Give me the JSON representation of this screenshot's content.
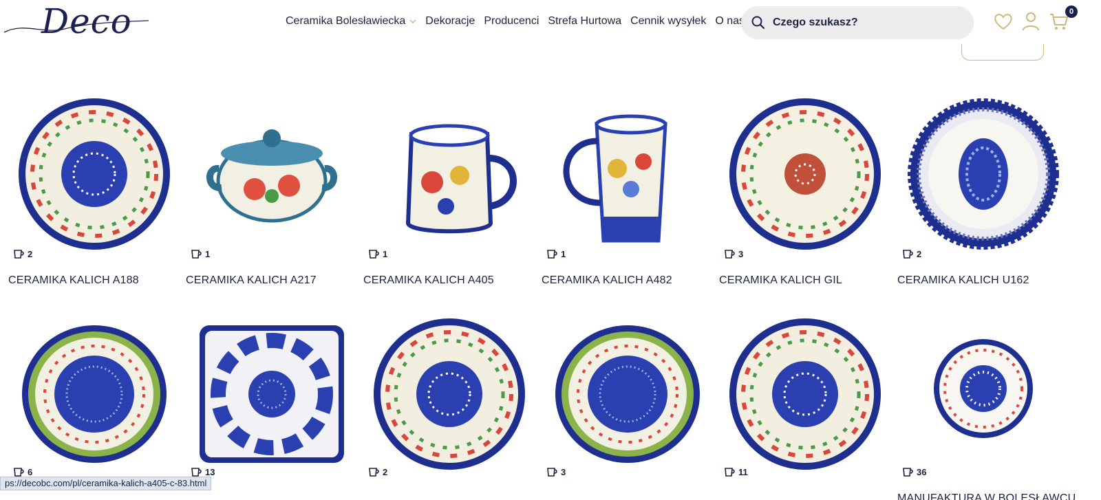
{
  "brand": {
    "logo_text": "Deco"
  },
  "nav": {
    "items": [
      "Ceramika Bolesławiecka",
      "Dekoracje",
      "Producenci",
      "Strefa Hurtowa",
      "Cennik wysyłek",
      "O nas"
    ]
  },
  "search": {
    "placeholder": "Czego szukasz?"
  },
  "header_icons": [
    "heart-icon",
    "user-icon",
    "cart-icon"
  ],
  "cart": {
    "count": "0"
  },
  "products": [
    {
      "name": "CERAMIKA KALICH A188",
      "count": "2",
      "kind": "plate"
    },
    {
      "name": "CERAMIKA KALICH A217",
      "count": "1",
      "kind": "pot"
    },
    {
      "name": "CERAMIKA KALICH A405",
      "count": "1",
      "kind": "mug"
    },
    {
      "name": "CERAMIKA KALICH A482",
      "count": "1",
      "kind": "tallmug"
    },
    {
      "name": "CERAMIKA KALICH GIL",
      "count": "3",
      "kind": "plate"
    },
    {
      "name": "CERAMIKA KALICH U162",
      "count": "2",
      "kind": "scallop"
    },
    {
      "name": "",
      "count": "6",
      "kind": "bowl"
    },
    {
      "name": "",
      "count": "13",
      "kind": "square"
    },
    {
      "name": "",
      "count": "2",
      "kind": "plate"
    },
    {
      "name": "",
      "count": "3",
      "kind": "bowl"
    },
    {
      "name": "",
      "count": "11",
      "kind": "plate"
    },
    {
      "name": "MANUFAKTURA W BOLESŁAWCU",
      "count": "36",
      "kind": "smallplate"
    }
  ],
  "status_url": "ps://decobc.com/pl/ceramika-kalich-a405-c-83.html",
  "colors": {
    "navy": "#1b2050",
    "gold": "#cdb77a",
    "cobalt": "#2a3fb0"
  }
}
